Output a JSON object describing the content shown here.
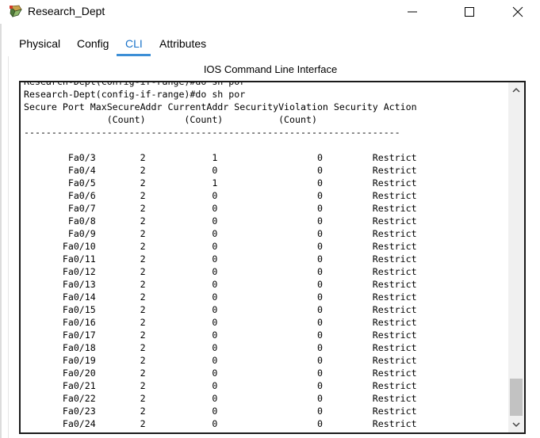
{
  "window": {
    "title": "Research_Dept",
    "minimize_icon": "minimize-icon",
    "maximize_icon": "maximize-icon",
    "close_icon": "close-icon"
  },
  "tabs": [
    {
      "label": "Physical"
    },
    {
      "label": "Config"
    },
    {
      "label": "CLI",
      "active": true
    },
    {
      "label": "Attributes"
    }
  ],
  "panel": {
    "title": "IOS Command Line Interface"
  },
  "terminal": {
    "lines": [
      "Research-Dept(config-if-range)#do sh por",
      "Research-Dept(config-if-range)#do sh por",
      "Secure Port MaxSecureAddr CurrentAddr SecurityViolation Security Action",
      "               (Count)       (Count)          (Count)",
      "--------------------------------------------------------------------",
      "",
      "        Fa0/3        2            1                  0         Restrict",
      "        Fa0/4        2            0                  0         Restrict",
      "        Fa0/5        2            1                  0         Restrict",
      "        Fa0/6        2            0                  0         Restrict",
      "        Fa0/7        2            0                  0         Restrict",
      "        Fa0/8        2            0                  0         Restrict",
      "        Fa0/9        2            0                  0         Restrict",
      "       Fa0/10        2            0                  0         Restrict",
      "       Fa0/11        2            0                  0         Restrict",
      "       Fa0/12        2            0                  0         Restrict",
      "       Fa0/13        2            0                  0         Restrict",
      "       Fa0/14        2            0                  0         Restrict",
      "       Fa0/15        2            0                  0         Restrict",
      "       Fa0/16        2            0                  0         Restrict",
      "       Fa0/17        2            0                  0         Restrict",
      "       Fa0/18        2            0                  0         Restrict",
      "       Fa0/19        2            0                  0         Restrict",
      "       Fa0/20        2            0                  0         Restrict",
      "       Fa0/21        2            0                  0         Restrict",
      "       Fa0/22        2            0                  0         Restrict",
      "       Fa0/23        2            0                  0         Restrict",
      "       Fa0/24        2            0                  0         Restrict",
      "----------------------------------------------------------------------"
    ]
  }
}
